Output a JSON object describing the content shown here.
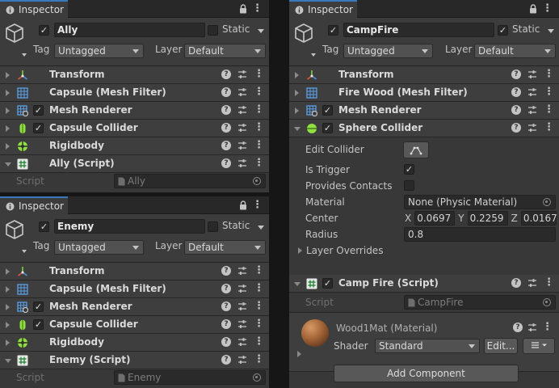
{
  "tab_title": "Inspector",
  "static_label": "Static",
  "tag_label": "Tag",
  "layer_label": "Layer",
  "tag_value": "Untagged",
  "layer_value": "Default",
  "script_label": "Script",
  "panels": [
    {
      "name": "Ally",
      "components": [
        {
          "name": "Transform"
        },
        {
          "name": "Capsule (Mesh Filter)"
        },
        {
          "name": "Mesh Renderer",
          "enabled": true
        },
        {
          "name": "Capsule Collider",
          "enabled": true
        },
        {
          "name": "Rigidbody"
        },
        {
          "name": "Ally (Script)"
        }
      ],
      "script_value": "Ally"
    },
    {
      "name": "Enemy",
      "components": [
        {
          "name": "Transform"
        },
        {
          "name": "Capsule (Mesh Filter)"
        },
        {
          "name": "Mesh Renderer",
          "enabled": true
        },
        {
          "name": "Capsule Collider",
          "enabled": true
        },
        {
          "name": "Rigidbody"
        },
        {
          "name": "Enemy (Script)"
        }
      ],
      "script_value": "Enemy"
    },
    {
      "name": "CampFire",
      "static": true,
      "components": [
        {
          "name": "Transform"
        },
        {
          "name": "Fire Wood (Mesh Filter)"
        },
        {
          "name": "Mesh Renderer",
          "enabled": true
        },
        {
          "name": "Sphere Collider",
          "enabled": true
        },
        {
          "name": "Camp Fire (Script)",
          "enabled": true
        }
      ],
      "collider": {
        "edit_label": "Edit Collider",
        "is_trigger_label": "Is Trigger",
        "is_trigger": true,
        "provides_contacts_label": "Provides Contacts",
        "provides_contacts": false,
        "material_label": "Material",
        "material_value": "None (Physic Material)",
        "center_label": "Center",
        "center": {
          "x": "0.0697",
          "y": "0.2259",
          "z": "0.0167"
        },
        "radius_label": "Radius",
        "radius_value": "0.8",
        "layer_overrides_label": "Layer Overrides"
      },
      "script_value": "CampFire",
      "material": {
        "name": "Wood1Mat (Material)",
        "shader_label": "Shader",
        "shader_value": "Standard",
        "edit_button": "Edit...",
        "list_icon": "list-icon"
      },
      "add_component_label": "Add Component"
    }
  ],
  "colors": {
    "panel_bg": "#383838",
    "tab_accent": "#3a79bb",
    "window_bg": "#161616"
  }
}
